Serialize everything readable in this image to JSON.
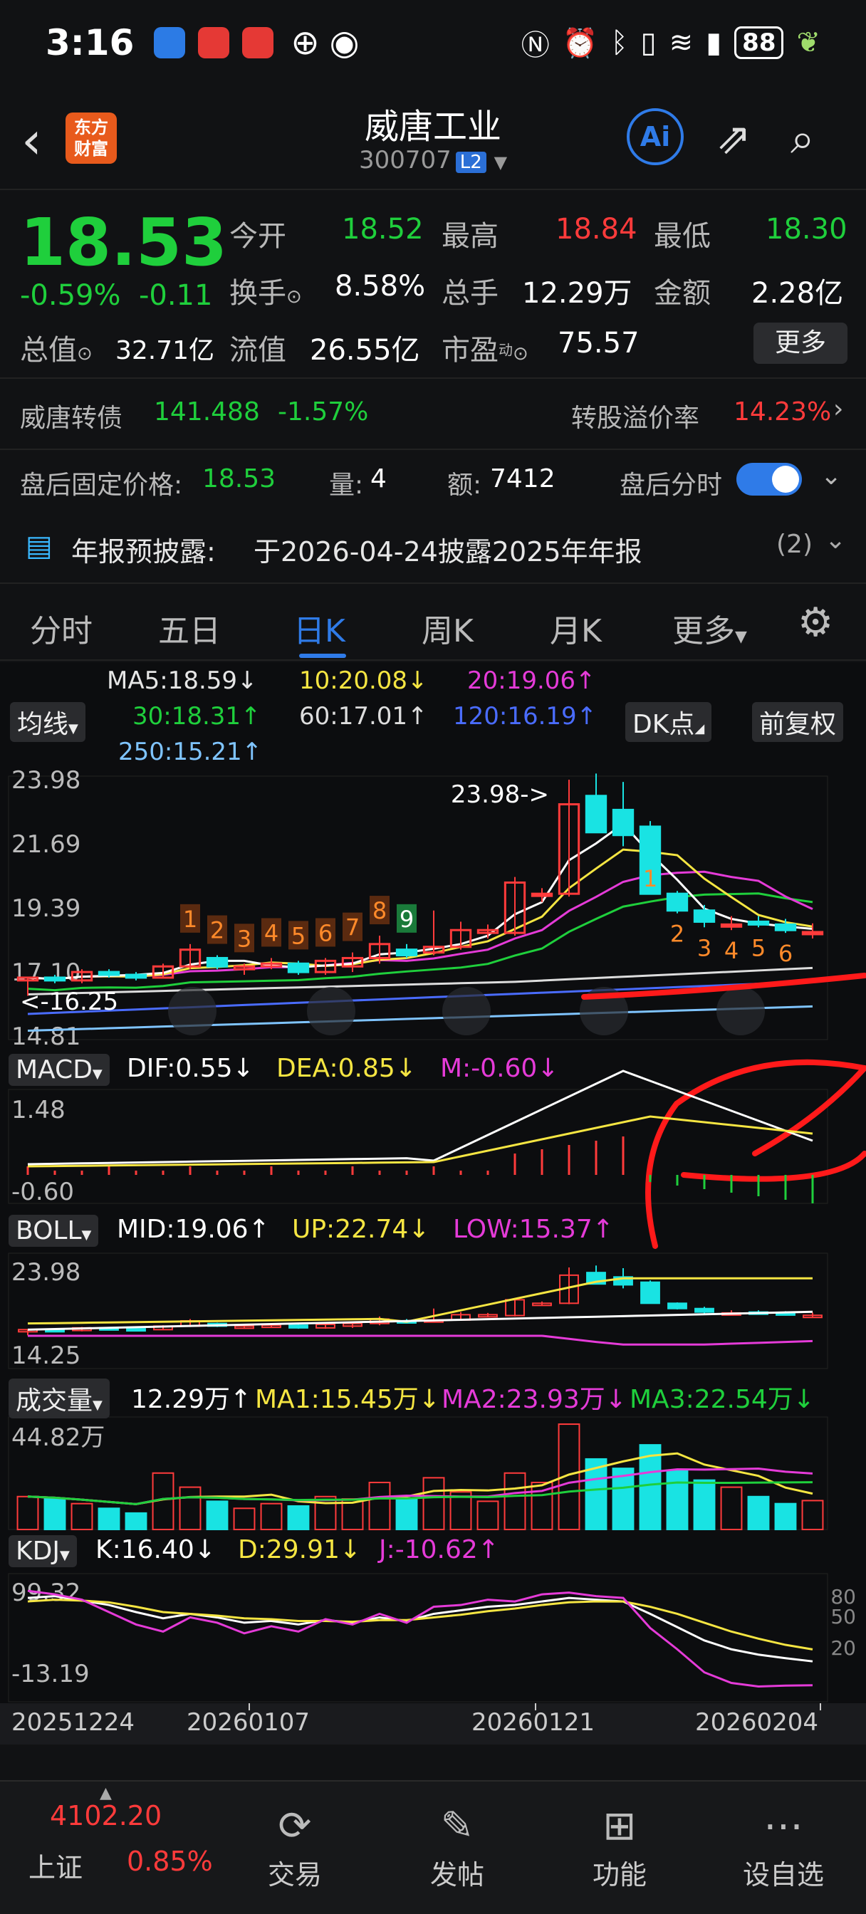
{
  "status_bar": {
    "time": "3:16",
    "battery": "88"
  },
  "header": {
    "logo_line1": "东方",
    "logo_line2": "财富",
    "title": "威唐工业",
    "code": "300707",
    "level_badge": "L2",
    "ai_label": "Ai"
  },
  "quote": {
    "price": "18.53",
    "change_pct": "-0.59%",
    "change": "-0.11",
    "open_label": "今开",
    "open": "18.52",
    "high_label": "最高",
    "high": "18.84",
    "low_label": "最低",
    "low": "18.30",
    "turnover_label": "换手",
    "turnover": "8.58%",
    "volume_label": "总手",
    "volume": "12.29万",
    "amount_label": "金额",
    "amount": "2.28亿",
    "mktcap_label": "总值",
    "mktcap": "32.71亿",
    "float_label": "流值",
    "float": "26.55亿",
    "pe_label": "市盈",
    "pe_sup": "动",
    "pe": "75.57",
    "more_button": "更多"
  },
  "bond": {
    "name": "威唐转债",
    "price": "141.488",
    "pct": "-1.57%",
    "premium_label": "转股溢价率",
    "premium": "14.23%"
  },
  "afterhours": {
    "label": "盘后固定价格:",
    "price": "18.53",
    "vol_label": "量:",
    "vol": "4",
    "amt_label": "额:",
    "amt": "7412",
    "switch_label": "盘后分时"
  },
  "notice": {
    "label": "年报预披露:",
    "text": "于2026-04-24披露2025年年报",
    "count": "(2)"
  },
  "tabs": [
    "分时",
    "五日",
    "日K",
    "周K",
    "月K",
    "更多"
  ],
  "active_tab": 2,
  "ma": {
    "ma5": "MA5:18.59↓",
    "ma10": "10:20.08↓",
    "ma20": "20:19.06↑",
    "ma30": "30:18.31↑",
    "ma60": "60:17.01↑",
    "ma120": "120:16.19↑",
    "ma250": "250:15.21↑",
    "selector": "均线",
    "dk": "DK点",
    "adjust": "前复权"
  },
  "main_chart": {
    "y_labels": [
      "23.98",
      "21.69",
      "19.39",
      "17.10",
      "14.81"
    ],
    "high_marker": "23.98->",
    "low_marker": "<-16.25",
    "seq_top": [
      "1",
      "2",
      "3",
      "4",
      "5",
      "6",
      "7",
      "8",
      "9"
    ],
    "seq_bottom": [
      "1",
      "2",
      "3",
      "4",
      "5",
      "6"
    ]
  },
  "macd": {
    "selector": "MACD",
    "dif": "DIF:0.55↓",
    "dea": "DEA:0.85↓",
    "m": "M:-0.60↓",
    "y_top": "1.48",
    "y_bottom": "-0.60"
  },
  "boll": {
    "selector": "BOLL",
    "mid": "MID:19.06↑",
    "up": "UP:22.74↓",
    "low": "LOW:15.37↑",
    "y_top": "23.98",
    "y_bottom": "14.25"
  },
  "vol": {
    "selector": "成交量",
    "value": "12.29万↑",
    "ma1": "MA1:15.45万↓",
    "ma2": "MA2:23.93万↓",
    "ma3": "MA3:22.54万↓",
    "y_top": "44.82万"
  },
  "kdj": {
    "selector": "KDJ",
    "k": "K:16.40↓",
    "d": "D:29.91↓",
    "j": "J:-10.62↑",
    "y_top": "99.32",
    "y_bottom": "-13.19",
    "r80": "80",
    "r50": "50",
    "r20": "20"
  },
  "x_axis": [
    "20251224",
    "20260107",
    "20260121",
    "20260204"
  ],
  "chart_data": {
    "type": "candlestick",
    "dates_shown": [
      "20251224",
      "20260107",
      "20260121",
      "20260204"
    ],
    "ohlc": [
      [
        16.8,
        16.9,
        16.25,
        16.9
      ],
      [
        16.9,
        17.0,
        16.7,
        16.8
      ],
      [
        16.8,
        17.2,
        16.7,
        17.1
      ],
      [
        17.1,
        17.2,
        16.9,
        17.0
      ],
      [
        17.0,
        17.1,
        16.8,
        16.9
      ],
      [
        16.9,
        17.4,
        16.9,
        17.3
      ],
      [
        17.3,
        18.1,
        17.2,
        17.9
      ],
      [
        17.6,
        17.7,
        17.2,
        17.3
      ],
      [
        17.2,
        17.4,
        17.0,
        17.3
      ],
      [
        17.3,
        17.6,
        17.2,
        17.4
      ],
      [
        17.4,
        17.5,
        17.0,
        17.1
      ],
      [
        17.1,
        17.6,
        17.0,
        17.5
      ],
      [
        17.3,
        17.8,
        17.1,
        17.6
      ],
      [
        17.6,
        18.4,
        17.4,
        18.1
      ],
      [
        17.9,
        18.1,
        17.6,
        17.7
      ],
      [
        17.8,
        19.3,
        17.7,
        18.0
      ],
      [
        18.0,
        18.9,
        17.9,
        18.6
      ],
      [
        18.5,
        18.8,
        18.3,
        18.6
      ],
      [
        18.5,
        20.5,
        18.4,
        20.3
      ],
      [
        19.9,
        20.1,
        19.6,
        19.9
      ],
      [
        19.9,
        23.98,
        19.8,
        23.1
      ],
      [
        23.4,
        24.2,
        22.8,
        22.1
      ],
      [
        22.9,
        23.9,
        21.6,
        22.0
      ],
      [
        22.3,
        22.5,
        19.9,
        19.9
      ],
      [
        19.9,
        20.0,
        19.2,
        19.3
      ],
      [
        19.3,
        19.5,
        18.7,
        18.9
      ],
      [
        18.8,
        19.1,
        18.6,
        18.8
      ],
      [
        18.9,
        19.1,
        18.7,
        18.8
      ],
      [
        18.8,
        19.0,
        18.5,
        18.6
      ],
      [
        18.52,
        18.84,
        18.3,
        18.53
      ]
    ],
    "ylim": [
      14.81,
      23.98
    ]
  }
}
